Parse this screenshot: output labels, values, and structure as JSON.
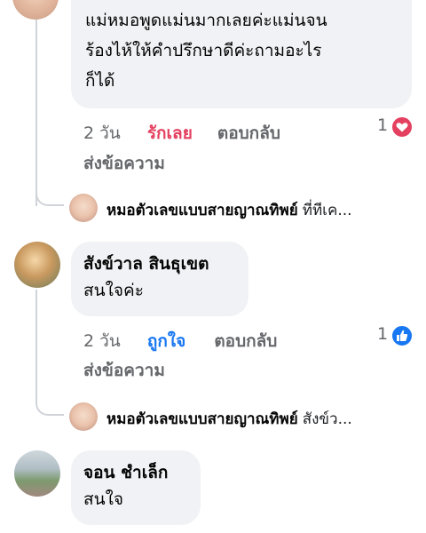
{
  "comments": [
    {
      "text": "แม่หมอพูดแม่นมากเลยค่ะแม่นจน\nร้องไห้ให้คำปรึกษาดีค่ะถามอะไร\nก็ได้",
      "time": "2 วัน",
      "reaction_label": "รักเลย",
      "reply_label": "ตอบกลับ",
      "send_message_label": "ส่งข้อความ",
      "reaction_count": "1",
      "reaction_icon": "heart-icon",
      "reaction_color": "#e4405f",
      "reply_preview": {
        "author": "หมอตัวเลขแบบสายญาณทิพย์",
        "snippet": "ที่ทีเค..."
      }
    },
    {
      "author": "สังข์วาล สินธุเขต",
      "text": "สนใจค่ะ",
      "time": "2 วัน",
      "reaction_label": "ถูกใจ",
      "reply_label": "ตอบกลับ",
      "send_message_label": "ส่งข้อความ",
      "reaction_count": "1",
      "reaction_icon": "like-icon",
      "reaction_color": "#1877f2",
      "reply_preview": {
        "author": "หมอตัวเลขแบบสายญาณทิพย์",
        "snippet": "สังข์ว..."
      }
    },
    {
      "author": "จอน ชำเล็ก",
      "text": "สนใจ"
    }
  ],
  "colors": {
    "bubble_bg": "#f0f2f5",
    "love": "#e4405f",
    "like": "#1877f2",
    "meta": "#65676b"
  }
}
